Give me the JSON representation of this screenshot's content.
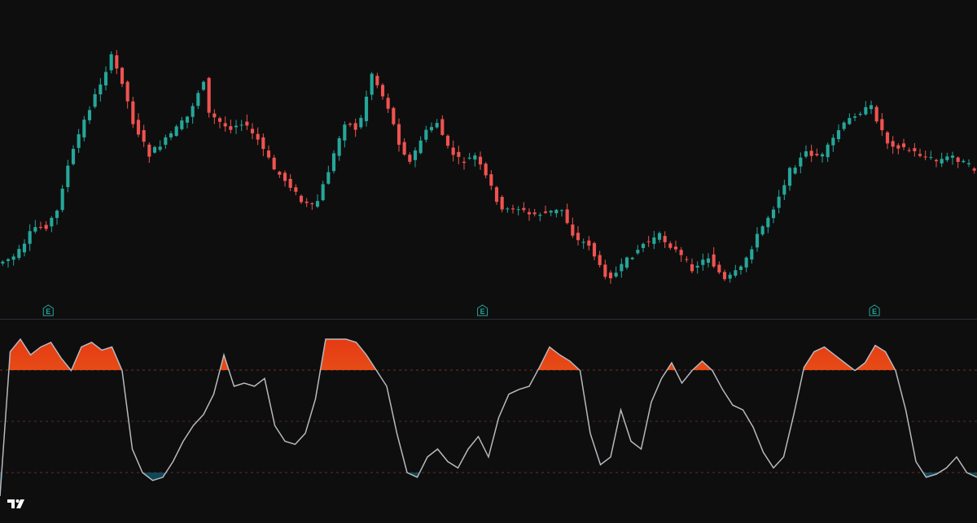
{
  "colors": {
    "background": "#0e0e0e",
    "up": "#26a69a",
    "down": "#ef5350",
    "oscillator_line": "#b7b9bf",
    "overbought_fill_top": "#e63a14",
    "overbought_fill_bottom": "#e8941f",
    "oversold_fill_top": "#1b8f9c",
    "oversold_fill_bottom": "#0d3e4a",
    "level_upper": "#7a2a2a",
    "level_mid": "#5a2a2a",
    "level_lower": "#6a2a2a",
    "badge": "#26a69a"
  },
  "earnings_markers": [
    {
      "label": "E",
      "bar": 8
    },
    {
      "label": "E",
      "bar": 80
    },
    {
      "label": "E",
      "bar": 145
    }
  ],
  "logo": "tradingview-logo-icon",
  "chart_data": [
    {
      "type": "candlestick",
      "title": "",
      "xlabel": "",
      "ylabel": "",
      "grid": false,
      "price_anchors": [
        [
          0,
          324
        ],
        [
          6,
          316
        ],
        [
          10,
          302
        ],
        [
          13,
          280
        ],
        [
          18,
          278
        ],
        [
          22,
          260
        ],
        [
          25,
          214
        ],
        [
          31,
          156
        ],
        [
          37,
          110
        ],
        [
          42,
          70
        ],
        [
          46,
          100
        ],
        [
          50,
          150
        ],
        [
          56,
          190
        ],
        [
          62,
          172
        ],
        [
          70,
          144
        ],
        [
          76,
          98
        ],
        [
          78,
          140
        ],
        [
          85,
          158
        ],
        [
          90,
          150
        ],
        [
          96,
          172
        ],
        [
          102,
          208
        ],
        [
          108,
          228
        ],
        [
          112,
          248
        ],
        [
          117,
          256
        ],
        [
          122,
          210
        ],
        [
          128,
          150
        ],
        [
          133,
          160
        ],
        [
          138,
          90
        ],
        [
          144,
          132
        ],
        [
          148,
          175
        ],
        [
          152,
          200
        ],
        [
          157,
          165
        ],
        [
          162,
          150
        ],
        [
          166,
          182
        ],
        [
          171,
          200
        ],
        [
          176,
          192
        ],
        [
          182,
          230
        ],
        [
          186,
          260
        ],
        [
          191,
          254
        ],
        [
          196,
          264
        ],
        [
          202,
          262
        ],
        [
          208,
          258
        ],
        [
          213,
          295
        ],
        [
          218,
          300
        ],
        [
          223,
          336
        ],
        [
          227,
          340
        ],
        [
          232,
          320
        ],
        [
          238,
          300
        ],
        [
          244,
          290
        ],
        [
          250,
          308
        ],
        [
          256,
          330
        ],
        [
          262,
          316
        ],
        [
          268,
          345
        ],
        [
          274,
          330
        ],
        [
          280,
          290
        ],
        [
          286,
          255
        ],
        [
          292,
          210
        ],
        [
          298,
          188
        ],
        [
          304,
          192
        ],
        [
          310,
          160
        ],
        [
          316,
          140
        ],
        [
          322,
          132
        ],
        [
          328,
          175
        ],
        [
          334,
          182
        ],
        [
          340,
          190
        ],
        [
          346,
          198
        ],
        [
          352,
          192
        ],
        [
          360,
          208
        ]
      ]
    },
    {
      "type": "line",
      "title": "",
      "ylim": [
        0,
        100
      ],
      "levels": {
        "upper": 80,
        "mid": 50,
        "lower": 20
      },
      "values": [
        0,
        92,
        100,
        90,
        95,
        98,
        88,
        80,
        95,
        98,
        93,
        95,
        80,
        30,
        15,
        10,
        12,
        22,
        35,
        45,
        52,
        65,
        90,
        70,
        72,
        70,
        75,
        45,
        35,
        33,
        40,
        62,
        100,
        100,
        100,
        98,
        90,
        80,
        70,
        40,
        15,
        12,
        25,
        30,
        22,
        18,
        30,
        38,
        25,
        50,
        65,
        68,
        70,
        82,
        95,
        90,
        86,
        80,
        40,
        20,
        25,
        55,
        35,
        30,
        60,
        75,
        85,
        72,
        80,
        86,
        80,
        68,
        58,
        55,
        44,
        28,
        18,
        25,
        52,
        82,
        92,
        95,
        90,
        85,
        80,
        85,
        96,
        92,
        80,
        55,
        22,
        12,
        14,
        18,
        25,
        15,
        12
      ]
    }
  ]
}
